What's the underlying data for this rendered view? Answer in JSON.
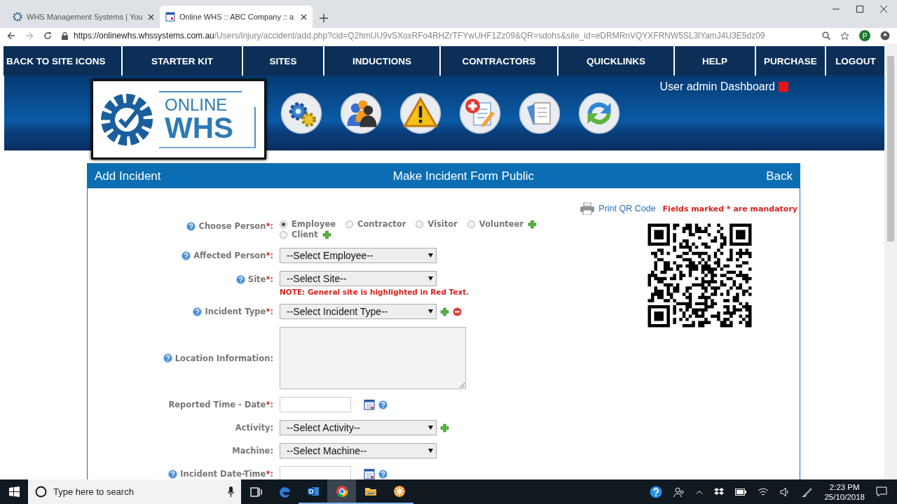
{
  "browser": {
    "tabs": [
      {
        "title": "WHS Management Systems | You",
        "kind": "gear",
        "selected": false
      },
      {
        "title": "Online WHS :: ABC Company :: a",
        "kind": "calendar",
        "selected": true
      }
    ],
    "address": {
      "host": "https://onlinewhs.whssystems.com.au",
      "path": "/Users/injury/accident/add.php?cid=Q2hmUU9vSXoxRFo4RHZrTFYwUHF1Zz09&QR=sdohs&site_id=eDRMRnVQYXFRNW5SL3lYamJ4U3E5dz09"
    },
    "profile_initial": "P"
  },
  "nav": [
    "BACK TO SITE ICONS",
    "STARTER KIT",
    "SITES",
    "INDUCTIONS",
    "CONTRACTORS",
    "QUICKLINKS",
    "HELP",
    "PURCHASE",
    "LOGOUT"
  ],
  "header": {
    "logo": {
      "top": "ONLINE",
      "bottom": "WHS"
    },
    "shortcuts": [
      {
        "kind": "gears"
      },
      {
        "kind": "people"
      },
      {
        "kind": "warning"
      },
      {
        "kind": "medical"
      },
      {
        "kind": "documents"
      },
      {
        "kind": "refresh"
      }
    ],
    "user_text": "User admin Dashboard"
  },
  "panel": {
    "title": "Add Incident",
    "center_link": "Make Incident Form Public",
    "back": "Back",
    "print_qr": "Print QR Code",
    "mandatory_note": "Fields marked * are mandatory",
    "fields": [
      {
        "kind": "radio",
        "label": "Choose Person",
        "asterisk": "*",
        "colon": ":",
        "help": true,
        "options": [
          {
            "label": "Employee",
            "selected": true,
            "add": false
          },
          {
            "label": "Contractor",
            "selected": false,
            "add": false
          },
          {
            "label": "Visitor",
            "selected": false,
            "add": false
          },
          {
            "label": "Volunteer",
            "selected": false,
            "add": true
          },
          {
            "label": "Client",
            "selected": false,
            "add": true
          }
        ]
      },
      {
        "kind": "select",
        "label": "Affected Person",
        "asterisk": "*",
        "colon": ":",
        "help": true,
        "value": "--Select Employee--"
      },
      {
        "kind": "select",
        "label": "Site",
        "asterisk": "*",
        "colon": ":",
        "help": true,
        "value": "--Select Site--",
        "note": "NOTE: General site is highlighted in Red Text."
      },
      {
        "kind": "select",
        "label": "Incident Type",
        "asterisk": "*",
        "colon": ":",
        "help": true,
        "value": "--Select Incident Type--",
        "add": true,
        "remove": true
      },
      {
        "kind": "textarea",
        "label": "Location Information",
        "colon": ":",
        "help": true
      },
      {
        "kind": "date",
        "label": "Reported Time - Date",
        "asterisk": "*",
        "colon": ":",
        "help": false,
        "calendar": true,
        "trailing_help": true
      },
      {
        "kind": "select",
        "label": "Activity",
        "colon": ":",
        "help": false,
        "value": "--Select Activity--",
        "add": true
      },
      {
        "kind": "select",
        "label": "Machine",
        "colon": ":",
        "help": false,
        "value": "--Select Machine--"
      },
      {
        "kind": "date",
        "label": "Incident Date-Time",
        "asterisk": "*",
        "colon": ":",
        "help": true,
        "calendar": true,
        "trailing_help": true
      }
    ]
  },
  "taskbar": {
    "search_placeholder": "Type here to search",
    "apps": [
      {
        "kind": "taskview",
        "active": false,
        "running": false
      },
      {
        "kind": "edge",
        "active": false,
        "running": false
      },
      {
        "kind": "outlook",
        "active": false,
        "running": true
      },
      {
        "kind": "chrome",
        "active": true,
        "running": true
      },
      {
        "kind": "folder",
        "active": false,
        "running": true
      },
      {
        "kind": "flower",
        "active": false,
        "running": true
      }
    ],
    "time": "2:23 PM",
    "date": "25/10/2018"
  }
}
